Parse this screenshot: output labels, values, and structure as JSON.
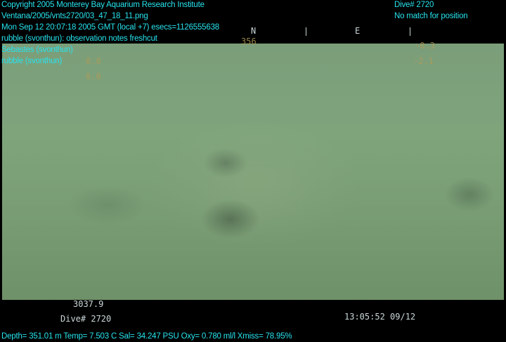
{
  "overlay_top_left": [
    "Copyright 2005 Monterey Bay Aquarium Research Institute",
    "Ventana/2005/vnts2720/03_47_18_11.png",
    "Mon Sep 12 20:07:18 2005 GMT (local +7)  esecs=1126555638",
    "rubble (svonthun): observation notes freshcut",
    "Sebastes (svonthun)",
    "rubble (svonthun)"
  ],
  "overlay_top_right": {
    "dive": "Dive# 2720",
    "position": "No match for position"
  },
  "camera_osd": {
    "compass_n": "N",
    "compass_e": "E",
    "heading": "356",
    "left_value_1": "0.0",
    "left_value_2": "0.0",
    "right_value_1": "-0.3",
    "right_value_2": "-2.1",
    "depth_readout": "3037.9",
    "dive_label": "Dive# 2720",
    "timestamp": "13:05:52 09/12"
  },
  "overlay_bottom": "Depth= 351.01 m  Temp= 7.503 C  Sal= 34.247 PSU  Oxy= 0.780 ml/l  Xmiss= 78.95%",
  "colors": {
    "overlay_text": "#27e3ee",
    "seafloor": "#7fa47c"
  }
}
